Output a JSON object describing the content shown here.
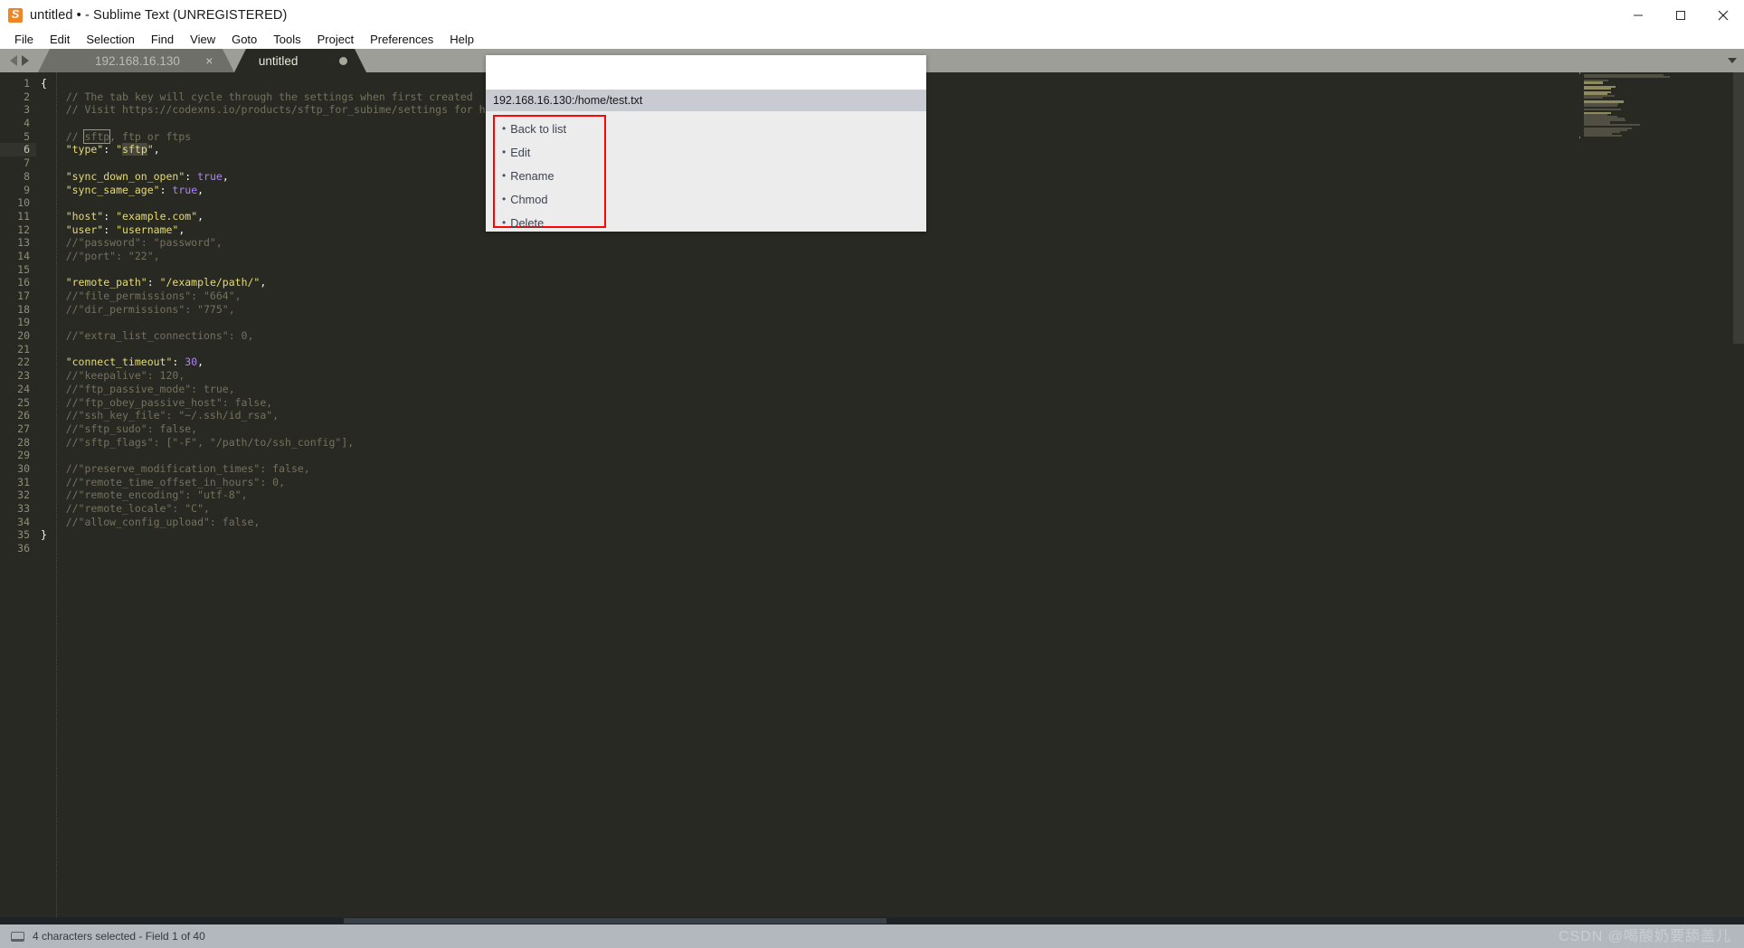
{
  "window": {
    "title": "untitled • - Sublime Text (UNREGISTERED)",
    "logo_letter": "S",
    "controls": {
      "minimize": "minimize-icon",
      "maximize": "maximize-icon",
      "close": "close-icon"
    }
  },
  "menubar": {
    "items": [
      {
        "label": "File"
      },
      {
        "label": "Edit"
      },
      {
        "label": "Selection"
      },
      {
        "label": "Find"
      },
      {
        "label": "View"
      },
      {
        "label": "Goto"
      },
      {
        "label": "Tools"
      },
      {
        "label": "Project"
      },
      {
        "label": "Preferences"
      },
      {
        "label": "Help"
      }
    ]
  },
  "tabs": {
    "items": [
      {
        "label": "192.168.16.130",
        "active": false,
        "close": "×"
      },
      {
        "label": "untitled",
        "active": true,
        "dirty": true
      }
    ]
  },
  "editor": {
    "first_line": 1,
    "last_line": 36,
    "current_line": 6,
    "lines": [
      {
        "n": 1,
        "tokens": [
          {
            "t": "{",
            "c": "c-pun"
          }
        ]
      },
      {
        "n": 2,
        "tokens": [
          {
            "t": "    // The tab key will cycle through the settings when first created",
            "c": "c-com"
          }
        ]
      },
      {
        "n": 3,
        "tokens": [
          {
            "t": "    // Visit https://codexns.io/products/sftp_for_subime/settings for help",
            "c": "c-com"
          }
        ]
      },
      {
        "n": 4,
        "tokens": []
      },
      {
        "n": 5,
        "tokens": [
          {
            "t": "    // ",
            "c": "c-com"
          },
          {
            "t": "sftp",
            "c": "c-com boxsel"
          },
          {
            "t": ", ftp or ftps",
            "c": "c-com"
          }
        ]
      },
      {
        "n": 6,
        "tokens": [
          {
            "t": "    \"type\"",
            "c": "c-key"
          },
          {
            "t": ": ",
            "c": "c-pun"
          },
          {
            "t": "\"",
            "c": "c-str"
          },
          {
            "t": "sftp",
            "c": "c-str sel"
          },
          {
            "t": "\"",
            "c": "c-str"
          },
          {
            "t": ",",
            "c": "c-pun"
          }
        ]
      },
      {
        "n": 7,
        "tokens": []
      },
      {
        "n": 8,
        "tokens": [
          {
            "t": "    \"sync_down_on_open\"",
            "c": "c-key"
          },
          {
            "t": ": ",
            "c": "c-pun"
          },
          {
            "t": "true",
            "c": "c-bool"
          },
          {
            "t": ",",
            "c": "c-pun"
          }
        ]
      },
      {
        "n": 9,
        "tokens": [
          {
            "t": "    \"sync_same_age\"",
            "c": "c-key"
          },
          {
            "t": ": ",
            "c": "c-pun"
          },
          {
            "t": "true",
            "c": "c-bool"
          },
          {
            "t": ",",
            "c": "c-pun"
          }
        ]
      },
      {
        "n": 10,
        "tokens": []
      },
      {
        "n": 11,
        "tokens": [
          {
            "t": "    \"host\"",
            "c": "c-key"
          },
          {
            "t": ": ",
            "c": "c-pun"
          },
          {
            "t": "\"example.com\"",
            "c": "c-str"
          },
          {
            "t": ",",
            "c": "c-pun"
          }
        ]
      },
      {
        "n": 12,
        "tokens": [
          {
            "t": "    \"user\"",
            "c": "c-key"
          },
          {
            "t": ": ",
            "c": "c-pun"
          },
          {
            "t": "\"username\"",
            "c": "c-str"
          },
          {
            "t": ",",
            "c": "c-pun"
          }
        ]
      },
      {
        "n": 13,
        "tokens": [
          {
            "t": "    //\"password\": \"password\",",
            "c": "c-com"
          }
        ]
      },
      {
        "n": 14,
        "tokens": [
          {
            "t": "    //\"port\": \"22\",",
            "c": "c-com"
          }
        ]
      },
      {
        "n": 15,
        "tokens": []
      },
      {
        "n": 16,
        "tokens": [
          {
            "t": "    \"remote_path\"",
            "c": "c-key"
          },
          {
            "t": ": ",
            "c": "c-pun"
          },
          {
            "t": "\"/example/path/\"",
            "c": "c-str"
          },
          {
            "t": ",",
            "c": "c-pun"
          }
        ]
      },
      {
        "n": 17,
        "tokens": [
          {
            "t": "    //\"file_permissions\": \"664\",",
            "c": "c-com"
          }
        ]
      },
      {
        "n": 18,
        "tokens": [
          {
            "t": "    //\"dir_permissions\": \"775\",",
            "c": "c-com"
          }
        ]
      },
      {
        "n": 19,
        "tokens": []
      },
      {
        "n": 20,
        "tokens": [
          {
            "t": "    //\"extra_list_connections\": 0,",
            "c": "c-com"
          }
        ]
      },
      {
        "n": 21,
        "tokens": []
      },
      {
        "n": 22,
        "tokens": [
          {
            "t": "    \"connect_timeout\"",
            "c": "c-key"
          },
          {
            "t": ": ",
            "c": "c-pun"
          },
          {
            "t": "30",
            "c": "c-num"
          },
          {
            "t": ",",
            "c": "c-pun"
          }
        ]
      },
      {
        "n": 23,
        "tokens": [
          {
            "t": "    //\"keepalive\": 120,",
            "c": "c-com"
          }
        ]
      },
      {
        "n": 24,
        "tokens": [
          {
            "t": "    //\"ftp_passive_mode\": true,",
            "c": "c-com"
          }
        ]
      },
      {
        "n": 25,
        "tokens": [
          {
            "t": "    //\"ftp_obey_passive_host\": false,",
            "c": "c-com"
          }
        ]
      },
      {
        "n": 26,
        "tokens": [
          {
            "t": "    //\"ssh_key_file\": \"~/.ssh/id_rsa\",",
            "c": "c-com"
          }
        ]
      },
      {
        "n": 27,
        "tokens": [
          {
            "t": "    //\"sftp_sudo\": false,",
            "c": "c-com"
          }
        ]
      },
      {
        "n": 28,
        "tokens": [
          {
            "t": "    //\"sftp_flags\": [\"-F\", \"/path/to/ssh_config\"],",
            "c": "c-com"
          }
        ]
      },
      {
        "n": 29,
        "tokens": []
      },
      {
        "n": 30,
        "tokens": [
          {
            "t": "    //\"preserve_modification_times\": false,",
            "c": "c-com"
          }
        ]
      },
      {
        "n": 31,
        "tokens": [
          {
            "t": "    //\"remote_time_offset_in_hours\": 0,",
            "c": "c-com"
          }
        ]
      },
      {
        "n": 32,
        "tokens": [
          {
            "t": "    //\"remote_encoding\": \"utf-8\",",
            "c": "c-com"
          }
        ]
      },
      {
        "n": 33,
        "tokens": [
          {
            "t": "    //\"remote_locale\": \"C\",",
            "c": "c-com"
          }
        ]
      },
      {
        "n": 34,
        "tokens": [
          {
            "t": "    //\"allow_config_upload\": false,",
            "c": "c-com"
          }
        ]
      },
      {
        "n": 35,
        "tokens": [
          {
            "t": "}",
            "c": "c-pun"
          }
        ]
      },
      {
        "n": 36,
        "tokens": []
      }
    ]
  },
  "popup": {
    "path": "192.168.16.130:/home/test.txt",
    "input_value": "",
    "highlight_color": "#fb0505",
    "menu": {
      "bullet": "•",
      "items": [
        {
          "label": "Back to list",
          "name": "back-to-list"
        },
        {
          "label": "Edit",
          "name": "edit"
        },
        {
          "label": "Rename",
          "name": "rename"
        },
        {
          "label": "Chmod",
          "name": "chmod"
        },
        {
          "label": "Delete",
          "name": "delete"
        }
      ]
    }
  },
  "statusbar": {
    "text": "4 characters selected - Field 1 of 40",
    "watermark": "CSDN @喝酸奶要舔盖儿"
  }
}
